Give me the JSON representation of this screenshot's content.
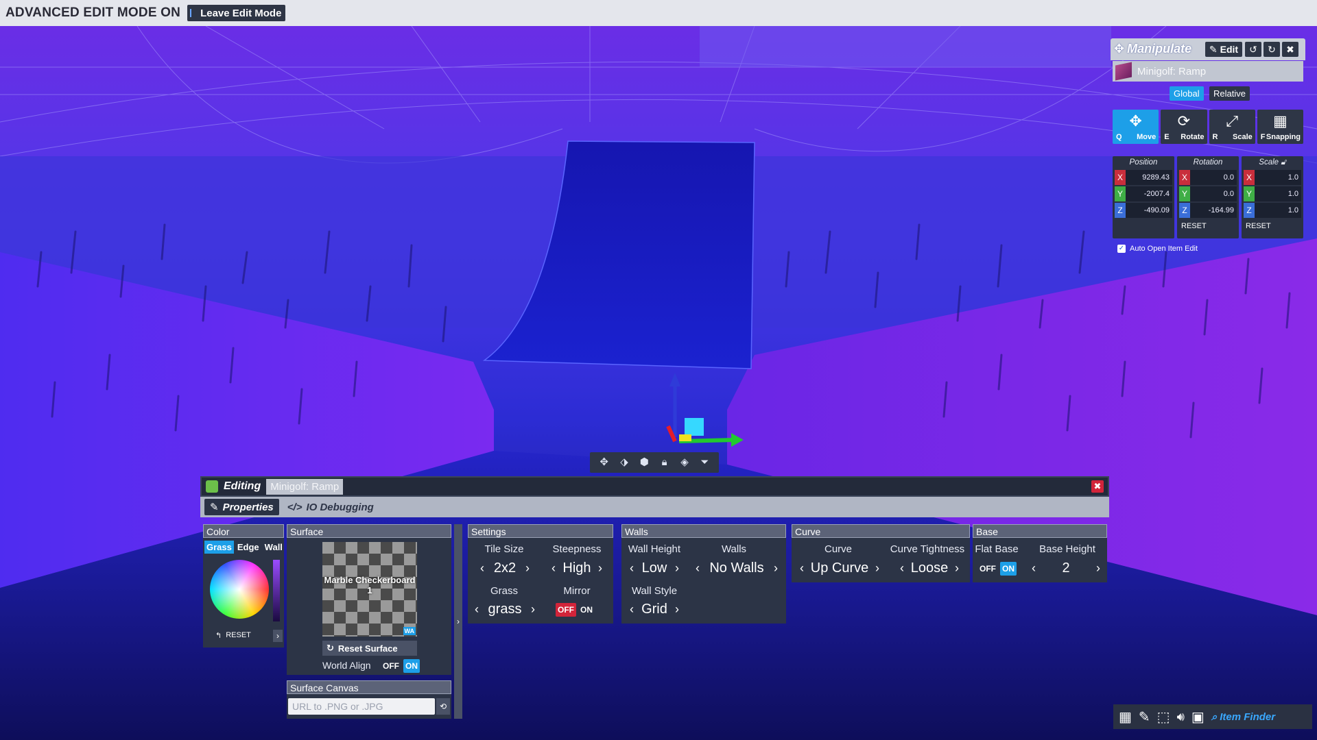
{
  "topbar": {
    "mode_text": "ADVANCED EDIT MODE ON",
    "leave_label": "Leave Edit Mode"
  },
  "viewport_tools": [
    "move-icon",
    "tag-icon",
    "shield-icon",
    "lock-icon",
    "cube-icon",
    "funnel-icon"
  ],
  "manipulate": {
    "title": "Manipulate",
    "edit_label": "Edit",
    "item_name": "Minigolf: Ramp",
    "space": {
      "global": "Global",
      "relative": "Relative",
      "selected": "Global"
    },
    "tools": [
      {
        "key": "Q",
        "label": "Move",
        "icon": "move-icon",
        "active": true
      },
      {
        "key": "E",
        "label": "Rotate",
        "icon": "rotate-icon",
        "active": false
      },
      {
        "key": "R",
        "label": "Scale",
        "icon": "scale-icon",
        "active": false
      },
      {
        "key": "F",
        "label": "Snapping",
        "icon": "grid-icon",
        "active": false
      }
    ],
    "position": {
      "title": "Position",
      "x": "9289.43",
      "y": "-2007.4",
      "z": "-490.09"
    },
    "rotation": {
      "title": "Rotation",
      "x": "0.0",
      "y": "0.0",
      "z": "-164.99",
      "reset": "RESET"
    },
    "scale": {
      "title": "Scale",
      "x": "1.0",
      "y": "1.0",
      "z": "1.0",
      "reset": "RESET"
    },
    "auto_open_label": "Auto Open Item Edit",
    "auto_open_checked": true
  },
  "editing": {
    "title": "Editing",
    "item_name": "Minigolf: Ramp",
    "tabs": {
      "properties": "Properties",
      "io": "IO Debugging"
    },
    "color": {
      "header": "Color",
      "tabs": [
        "Grass",
        "Edge",
        "Wall"
      ],
      "selected_tab": "Grass",
      "reset": "RESET"
    },
    "surface": {
      "header": "Surface",
      "texture_name": "Marble Checkerboard 1",
      "texture_badge": "WA",
      "reset_label": "Reset Surface",
      "world_align_label": "World Align",
      "off": "OFF",
      "on": "ON"
    },
    "surface_canvas": {
      "header": "Surface Canvas",
      "placeholder": "URL to .PNG or .JPG"
    },
    "settings": {
      "header": "Settings",
      "tile_size_label": "Tile Size",
      "tile_size": "2x2",
      "steepness_label": "Steepness",
      "steepness": "High",
      "grass_label": "Grass",
      "grass": "grass",
      "mirror_label": "Mirror",
      "off": "OFF",
      "on": "ON",
      "mirror_value": "OFF"
    },
    "walls": {
      "header": "Walls",
      "wall_height_label": "Wall Height",
      "wall_height": "Low",
      "walls_label": "Walls",
      "walls": "No Walls",
      "wall_style_label": "Wall Style",
      "wall_style": "Grid"
    },
    "curve": {
      "header": "Curve",
      "curve_label": "Curve",
      "curve": "Up Curve",
      "tightness_label": "Curve Tightness",
      "tightness": "Loose"
    },
    "base": {
      "header": "Base",
      "flat_base_label": "Flat Base",
      "off": "OFF",
      "on": "ON",
      "flat_base_value": "ON",
      "base_height_label": "Base Height",
      "base_height": "2"
    }
  },
  "bottom_toolbar": {
    "item_finder": "Item Finder"
  }
}
